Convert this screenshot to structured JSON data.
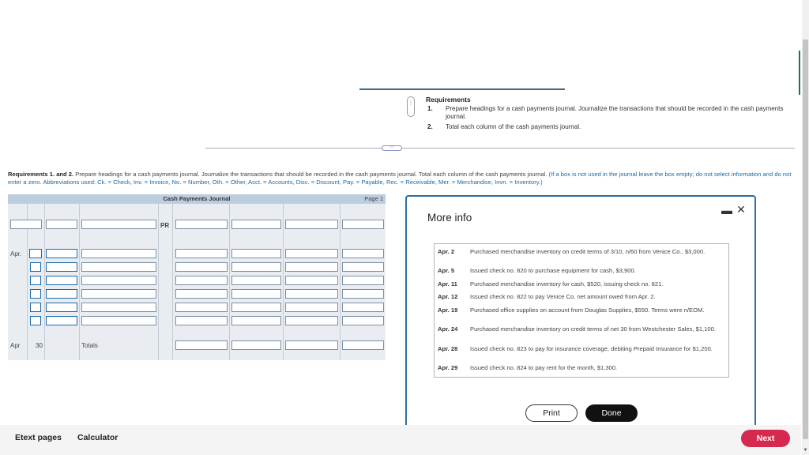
{
  "requirements_panel": {
    "title": "Requirements",
    "items": [
      {
        "num": "1.",
        "text": "Prepare headings for a cash payments journal. Journalize the transactions that should be recorded in the cash payments journal."
      },
      {
        "num": "2.",
        "text": "Total each column of the cash payments journal."
      }
    ],
    "handle_glyph": "⋮",
    "divider_glyph": "⋯"
  },
  "instructions": {
    "bold": "Requirements 1. and 2.",
    "main": "Prepare headings for a cash payments journal. Journalize the transactions that should be recorded in the cash payments journal. Total each column of the cash payments journal.",
    "hint": "(If a box is not used in the journal leave the box empty; do not select information and do not enter a zero. Abbreviations used: Ck. = Check, Inv. = Invoice, No. = Number, Oth. = Other, Acct. = Accounts, Disc. = Discount, Pay. = Payable, Rec. = Receivable, Mer. = Merchandise, Invn. = Inventory.)"
  },
  "journal": {
    "title": "Cash Payments Journal",
    "page": "Page 1",
    "pr_label": "PR",
    "first_row_month": "Apr.",
    "totals_row": {
      "month": "Apr",
      "day": "30",
      "label": "Totals"
    }
  },
  "modal": {
    "title": "More info",
    "minimize_glyph": "▬",
    "close_glyph": "✕",
    "transactions": [
      {
        "date": "Apr. 2",
        "text": "Purchased merchandise inventory on credit terms of 3/10, n/60 from Venice Co., $3,000."
      },
      {
        "date": "Apr. 5",
        "text": "Issued check no. 820 to purchase equipment for cash, $3,900."
      },
      {
        "date": "Apr. 11",
        "text": "Purchased merchandise inventory for cash, $520, issuing check no. 821."
      },
      {
        "date": "Apr. 12",
        "text": "Issued check no. 822 to pay Venice Co. net amount owed from Apr. 2."
      },
      {
        "date": "Apr. 19",
        "text": "Purchased office supplies on account from Douglas Supplies, $550. Terms were n/EOM."
      },
      {
        "date": "Apr. 24",
        "text": "Purchased merchandise inventory on credit terms of net 30 from Westchester Sales, $1,100."
      },
      {
        "date": "Apr. 28",
        "text": "Issued check no. 823 to pay for insurance coverage, debiting Prepaid Insurance for $1,200."
      },
      {
        "date": "Apr. 29",
        "text": "Issued check no. 824 to pay rent for the month, $1,300."
      }
    ],
    "print_label": "Print",
    "done_label": "Done"
  },
  "footer": {
    "etext_label": "Etext pages",
    "calculator_label": "Calculator",
    "next_label": "Next"
  },
  "colors": {
    "accent": "#2d6ea0",
    "next_button": "#d6294f",
    "journal_header": "#bccde0"
  }
}
